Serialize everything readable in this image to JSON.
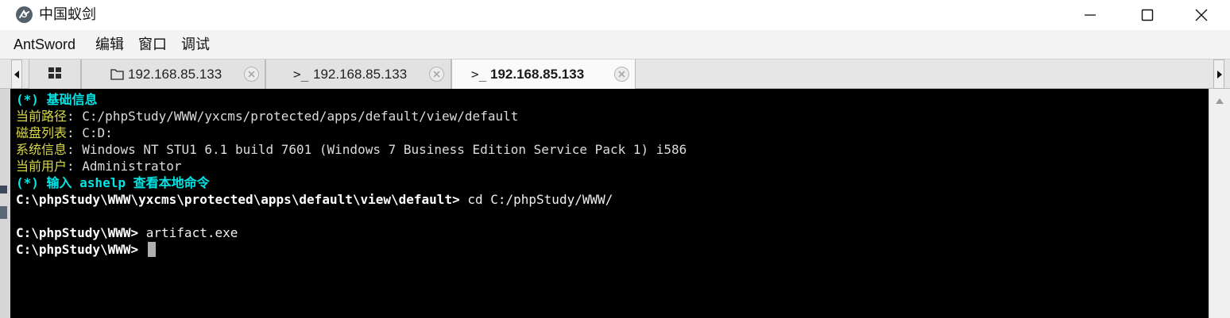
{
  "window": {
    "title": "中国蚁剑",
    "icon": "antsword-logo-icon"
  },
  "menu": {
    "items": [
      {
        "label": "AntSword"
      },
      {
        "label": "编辑"
      },
      {
        "label": "窗口"
      },
      {
        "label": "调试"
      }
    ]
  },
  "tabs": [
    {
      "icon": "grid-icon",
      "label": ""
    },
    {
      "icon": "folder-icon",
      "label": "192.168.85.133",
      "closable": true
    },
    {
      "icon": "terminal-icon",
      "icon_text": ">_",
      "label": "192.168.85.133",
      "closable": true
    },
    {
      "icon": "terminal-icon",
      "icon_text": ">_",
      "label": "192.168.85.133",
      "closable": true,
      "active": true
    }
  ],
  "terminal": {
    "info_header": "(*) 基础信息",
    "rows": [
      {
        "label": "当前路径",
        "value": "C:/phpStudy/WWW/yxcms/protected/apps/default/view/default"
      },
      {
        "label": "磁盘列表",
        "value": "C:D:"
      },
      {
        "label": "系统信息",
        "value": "Windows NT STU1 6.1 build 7601 (Windows 7 Business Edition Service Pack 1) i586"
      },
      {
        "label": "当前用户",
        "value": "Administrator"
      }
    ],
    "help_hint": "(*) 输入 ashelp 查看本地命令",
    "commands": [
      {
        "prompt": "C:\\phpStudy\\WWW\\yxcms\\protected\\apps\\default\\view\\default>",
        "command": "cd C:/phpStudy/WWW/"
      },
      {
        "prompt": "C:\\phpStudy\\WWW>",
        "command": "artifact.exe"
      },
      {
        "prompt": "C:\\phpStudy\\WWW>",
        "command": ""
      }
    ],
    "colors": {
      "background": "#000000",
      "header": "#00e5e5",
      "label": "#d8d84a",
      "text": "#dcdcdc",
      "prompt": "#ffffff"
    }
  }
}
